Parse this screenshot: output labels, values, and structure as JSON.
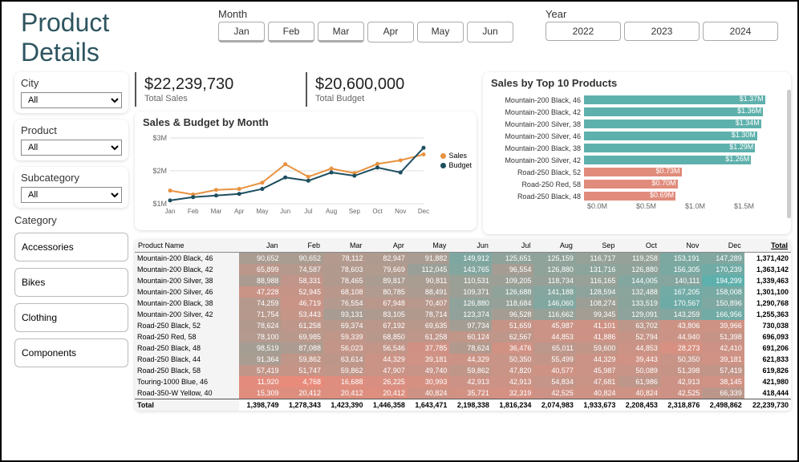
{
  "title": "Product Details",
  "monthSlicer": {
    "label": "Month",
    "items": [
      "Jan",
      "Feb",
      "Mar",
      "Apr",
      "May",
      "Jun"
    ]
  },
  "yearSlicer": {
    "label": "Year",
    "items": [
      "2022",
      "2023",
      "2024"
    ]
  },
  "filters": {
    "city": {
      "label": "City",
      "value": "All"
    },
    "product": {
      "label": "Product",
      "value": "All"
    },
    "subcat": {
      "label": "Subcategory",
      "value": "All"
    }
  },
  "category": {
    "label": "Category",
    "items": [
      "Accessories",
      "Bikes",
      "Clothing",
      "Components"
    ]
  },
  "kpis": {
    "sales": {
      "value": "$22,239,730",
      "label": "Total Sales"
    },
    "budget": {
      "value": "$20,600,000",
      "label": "Total Budget"
    }
  },
  "lineChart": {
    "title": "Sales & Budget by Month",
    "legend": {
      "sales": "Sales",
      "budget": "Budget"
    },
    "yTicks": [
      "$3M",
      "$2M",
      "$1M"
    ]
  },
  "barChart": {
    "title": "Sales by Top 10 Products",
    "axis": [
      "$0.0M",
      "$0.5M",
      "$1.0M",
      "$1.5M"
    ],
    "colors": {
      "teal": "#5eb0ac",
      "coral": "#e08b7b"
    },
    "items": [
      {
        "name": "Mountain-200 Black, 46",
        "val": "$1.37M",
        "pct": 91,
        "c": "teal"
      },
      {
        "name": "Mountain-200 Black, 42",
        "val": "$1.36M",
        "pct": 90,
        "c": "teal"
      },
      {
        "name": "Mountain-200 Silver, 38",
        "val": "$1.34M",
        "pct": 89,
        "c": "teal"
      },
      {
        "name": "Mountain-200 Silver, 46",
        "val": "$1.30M",
        "pct": 87,
        "c": "teal"
      },
      {
        "name": "Mountain-200 Black, 38",
        "val": "$1.29M",
        "pct": 86,
        "c": "teal"
      },
      {
        "name": "Mountain-200 Silver, 42",
        "val": "$1.26M",
        "pct": 84,
        "c": "teal"
      },
      {
        "name": "Road-250 Black, 52",
        "val": "$0.73M",
        "pct": 49,
        "c": "coral"
      },
      {
        "name": "Road-250 Red, 58",
        "val": "$0.70M",
        "pct": 47,
        "c": "coral"
      },
      {
        "name": "Road-250 Black, 48",
        "val": "$0.69M",
        "pct": 46,
        "c": "coral"
      }
    ]
  },
  "table": {
    "headers": [
      "Product Name",
      "Jan",
      "Feb",
      "Mar",
      "Apr",
      "May",
      "Jun",
      "Jul",
      "Aug",
      "Sep",
      "Oct",
      "Nov",
      "Dec",
      "Total"
    ],
    "rows": [
      {
        "name": "Mountain-200 Black, 46",
        "v": [
          "90,652",
          "90,652",
          "78,112",
          "82,947",
          "91,882",
          "149,912",
          "125,651",
          "125,159",
          "116,717",
          "119,258",
          "153,191",
          "147,289"
        ],
        "t": "1,371,420"
      },
      {
        "name": "Mountain-200 Black, 42",
        "v": [
          "65,899",
          "74,587",
          "78,603",
          "79,669",
          "112,045",
          "143,765",
          "96,554",
          "126,880",
          "131,716",
          "126,880",
          "156,305",
          "170,239"
        ],
        "t": "1,363,142"
      },
      {
        "name": "Mountain-200 Silver, 38",
        "v": [
          "88,988",
          "58,331",
          "78,465",
          "89,817",
          "90,811",
          "110,531",
          "109,205",
          "118,734",
          "116,165",
          "144,005",
          "140,111",
          "194,299"
        ],
        "t": "1,339,463"
      },
      {
        "name": "Mountain-200 Silver, 46",
        "v": [
          "47,228",
          "52,945",
          "68,108",
          "80,785",
          "88,491",
          "109,371",
          "126,688",
          "141,188",
          "128,594",
          "132,488",
          "167,205",
          "158,008"
        ],
        "t": "1,301,100"
      },
      {
        "name": "Mountain-200 Black, 38",
        "v": [
          "74,259",
          "46,719",
          "76,554",
          "67,948",
          "70,407",
          "126,880",
          "118,684",
          "146,060",
          "108,274",
          "133,519",
          "170,567",
          "150,896"
        ],
        "t": "1,290,768"
      },
      {
        "name": "Mountain-200 Silver, 42",
        "v": [
          "71,754",
          "53,443",
          "93,131",
          "83,105",
          "78,714",
          "123,374",
          "96,528",
          "116,662",
          "99,345",
          "129,091",
          "143,259",
          "166,956"
        ],
        "t": "1,255,363"
      },
      {
        "name": "Road-250 Black, 52",
        "v": [
          "78,624",
          "61,258",
          "69,374",
          "67,192",
          "69,635",
          "97,734",
          "51,659",
          "45,987",
          "41,101",
          "63,702",
          "43,806",
          "39,966"
        ],
        "t": "730,038"
      },
      {
        "name": "Road-250 Red, 58",
        "v": [
          "78,100",
          "69,985",
          "59,339",
          "68,850",
          "61,258",
          "60,124",
          "62,567",
          "44,853",
          "41,886",
          "52,794",
          "44,940",
          "51,398"
        ],
        "t": "696,093"
      },
      {
        "name": "Road-250 Black, 48",
        "v": [
          "98,519",
          "87,088",
          "56,023",
          "56,546",
          "37,785",
          "78,624",
          "36,476",
          "65,011",
          "59,600",
          "44,853",
          "28,273",
          "42,410"
        ],
        "t": "691,206"
      },
      {
        "name": "Road-250 Black, 44",
        "v": [
          "91,364",
          "59,862",
          "63,614",
          "44,329",
          "39,181",
          "44,329",
          "50,350",
          "55,499",
          "44,329",
          "39,443",
          "50,350",
          "39,181"
        ],
        "t": "621,833"
      },
      {
        "name": "Road-250 Black, 58",
        "v": [
          "57,419",
          "51,747",
          "59,862",
          "47,907",
          "49,740",
          "59,862",
          "47,820",
          "40,577",
          "45,987",
          "50,089",
          "51,398",
          "57,419"
        ],
        "t": "619,826"
      },
      {
        "name": "Touring-1000 Blue, 46",
        "v": [
          "11,920",
          "4,768",
          "16,688",
          "26,225",
          "30,993",
          "42,913",
          "42,913",
          "54,834",
          "47,681",
          "61,986",
          "42,913",
          "38,145"
        ],
        "t": "421,980"
      },
      {
        "name": "Road-350-W Yellow, 40",
        "v": [
          "15,309",
          "20,412",
          "20,412",
          "20,412",
          "40,824",
          "35,721",
          "32,319",
          "42,525",
          "40,824",
          "40,824",
          "42,525",
          "66,339"
        ],
        "t": "418,444"
      }
    ],
    "total": {
      "name": "Total",
      "v": [
        "1,398,749",
        "1,278,343",
        "1,423,390",
        "1,446,358",
        "1,643,471",
        "2,198,338",
        "1,816,234",
        "2,074,983",
        "1,933,673",
        "2,208,453",
        "2,318,876",
        "2,498,862"
      ],
      "t": "22,239,730"
    }
  },
  "chart_data": [
    {
      "type": "line",
      "title": "Sales & Budget by Month",
      "categories": [
        "Jan",
        "Feb",
        "Mar",
        "Apr",
        "May",
        "Jun",
        "Jul",
        "Aug",
        "Sep",
        "Oct",
        "Nov",
        "Dec"
      ],
      "series": [
        {
          "name": "Sales",
          "color": "#e8913f",
          "values": [
            1.4,
            1.28,
            1.42,
            1.45,
            1.64,
            2.2,
            1.82,
            2.07,
            1.93,
            2.21,
            2.32,
            2.5
          ]
        },
        {
          "name": "Budget",
          "color": "#1d4e5f",
          "values": [
            1.1,
            1.2,
            1.25,
            1.3,
            1.45,
            1.8,
            1.7,
            1.95,
            1.85,
            2.1,
            1.95,
            2.7
          ]
        }
      ],
      "ylabel": "$M",
      "ylim": [
        1,
        3
      ]
    },
    {
      "type": "bar",
      "title": "Sales by Top 10 Products",
      "categories": [
        "Mountain-200 Black, 46",
        "Mountain-200 Black, 42",
        "Mountain-200 Silver, 38",
        "Mountain-200 Silver, 46",
        "Mountain-200 Black, 38",
        "Mountain-200 Silver, 42",
        "Road-250 Black, 52",
        "Road-250 Red, 58",
        "Road-250 Black, 48"
      ],
      "values": [
        1.37,
        1.36,
        1.34,
        1.3,
        1.29,
        1.26,
        0.73,
        0.7,
        0.69
      ],
      "xlabel": "$M",
      "xlim": [
        0,
        1.5
      ]
    }
  ]
}
